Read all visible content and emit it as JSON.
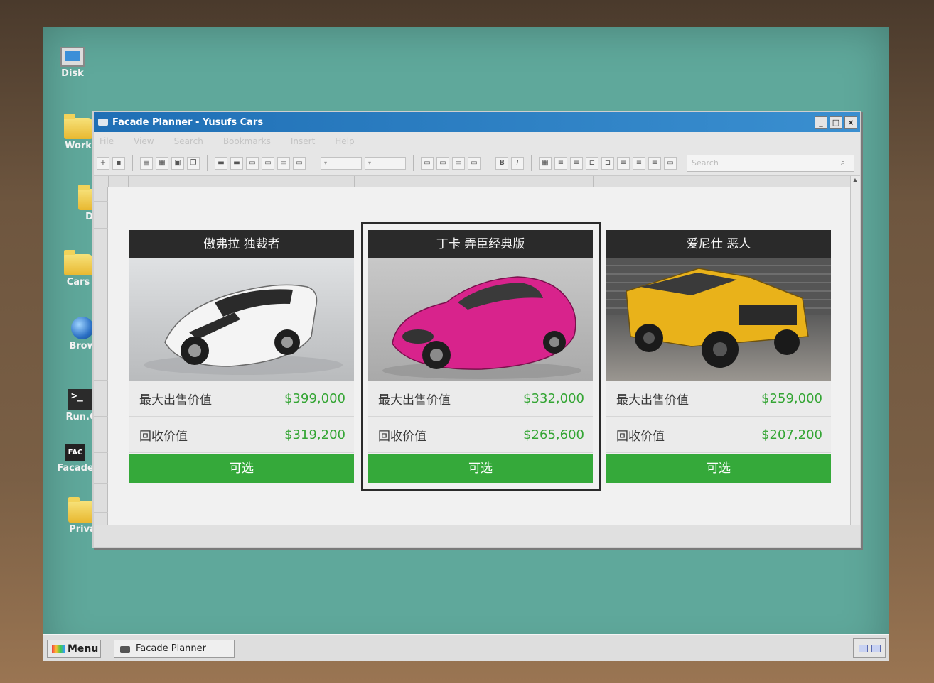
{
  "desktop": {
    "icons": [
      {
        "label": "Disk",
        "icon": "computer-icon"
      },
      {
        "label": "Work",
        "icon": "folder-icon"
      },
      {
        "label": "Do",
        "icon": "folder-icon"
      },
      {
        "label": "Cars",
        "icon": "folder-icon"
      },
      {
        "label": "Brow",
        "icon": "globe-icon"
      },
      {
        "label": "Run.C",
        "icon": "terminal-icon"
      },
      {
        "label": "Facade",
        "icon": "facade-icon"
      },
      {
        "label": "Priva",
        "icon": "folder-icon"
      }
    ]
  },
  "window": {
    "title": "Facade Planner - Yusufs Cars",
    "menu": [
      "File",
      "View",
      "Search",
      "Bookmarks",
      "Insert",
      "Help"
    ],
    "search_placeholder": "Search"
  },
  "cards": [
    {
      "name": "傲弗拉 独裁者",
      "max_sale_label": "最大出售价值",
      "max_sale_value": "$399,000",
      "trade_in_label": "回收价值",
      "trade_in_value": "$319,200",
      "button": "可选"
    },
    {
      "name": "丁卡 弄臣经典版",
      "max_sale_label": "最大出售价值",
      "max_sale_value": "$332,000",
      "trade_in_label": "回收价值",
      "trade_in_value": "$265,600",
      "button": "可选",
      "selected": true
    },
    {
      "name": "爱尼仕 恶人",
      "max_sale_label": "最大出售价值",
      "max_sale_value": "$259,000",
      "trade_in_label": "回收价值",
      "trade_in_value": "$207,200",
      "button": "可选"
    }
  ],
  "taskbar": {
    "menu_label": "Menu",
    "task_label": "Facade Planner"
  },
  "colors": {
    "desktop": "#5fa89b",
    "titlebar": "#1f6fb5",
    "price_green": "#34a534",
    "button_green": "#35a93a",
    "card_header": "#2a2a2a"
  }
}
